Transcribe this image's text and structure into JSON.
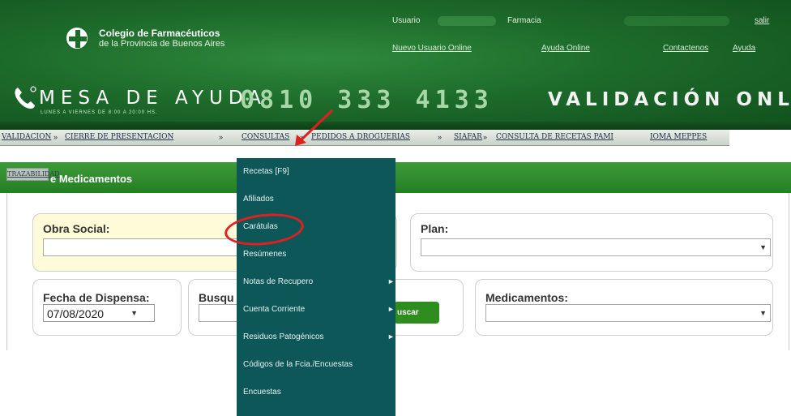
{
  "header": {
    "logo_line1": "Colegio de Farmacéuticos",
    "logo_line2": "de la Provincia de Buenos Aires",
    "usuario_label": "Usuario",
    "farmacia_label": "Farmacia",
    "salir": "salir",
    "nuevo_usuario": "Nuevo Usuario Online",
    "ayuda_online": "Ayuda Online",
    "contactenos": "Contactenos",
    "ayuda": "Ayuda",
    "mesa_de_ayuda": "MESA DE AYUDA",
    "mesa_sub": "LUNES A VIERNES DE 8:00 A 20:00 HS.",
    "phone": "0810 333 4133",
    "validacion": "VALIDACIÓN ONLINE"
  },
  "menubar": {
    "items": [
      "VALIDACION",
      "CIERRE DE PRESENTACION",
      "CONSULTAS",
      "PEDIDOS A DROGUERIAS",
      "SIAFAR",
      "CONSULTA DE RECETAS PAMI",
      "IOMA MEPPES"
    ],
    "submenu": "TRAZABILIDAD",
    "separator": "»"
  },
  "page": {
    "title": "e Medicamentos"
  },
  "form": {
    "obra_social_label": "Obra Social:",
    "plan_label": "Plan:",
    "fecha_label": "Fecha de Dispensa:",
    "fecha_value": "07/08/2020",
    "busqueda_label": "Busqu",
    "medicamentos_label": "Medicamentos:",
    "buscar_label": "uscar"
  },
  "dropdown": {
    "items": [
      {
        "label": "Recetas [F9]",
        "submenu": false
      },
      {
        "label": "Afiliados",
        "submenu": false
      },
      {
        "label": "Carátulas",
        "submenu": false
      },
      {
        "label": "Resúmenes",
        "submenu": false
      },
      {
        "label": "Notas de Recupero",
        "submenu": true
      },
      {
        "label": "Cuenta Corriente",
        "submenu": true
      },
      {
        "label": "Residuos Patogénicos",
        "submenu": true
      },
      {
        "label": "Códigos de la Fcia./Encuestas",
        "submenu": false
      },
      {
        "label": "Encuestas",
        "submenu": false
      }
    ]
  },
  "colors": {
    "header_green": "#1d6b2b",
    "title_green": "#2f8a2e",
    "dropdown_teal": "#0e5758",
    "annotation_red": "#e02020",
    "yellow_box": "#fefbd8"
  },
  "icons": [
    "pharmacy-cross-logo-icon",
    "phone-icon",
    "chevron-right-icon",
    "dropdown-arrow-icon"
  ]
}
